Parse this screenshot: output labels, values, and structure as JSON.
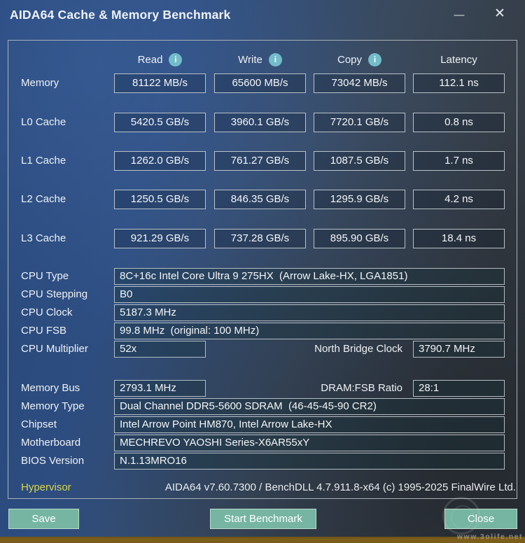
{
  "window": {
    "title": "AIDA64 Cache & Memory Benchmark",
    "minimize_glyph": "—",
    "close_glyph": "✕"
  },
  "icons": {
    "info_glyph": "i"
  },
  "columns": {
    "read": "Read",
    "write": "Write",
    "copy": "Copy",
    "latency": "Latency"
  },
  "benchmark_rows": [
    {
      "label": "Memory",
      "read": "81122 MB/s",
      "write": "65600 MB/s",
      "copy": "73042 MB/s",
      "latency": "112.1 ns"
    },
    {
      "label": "L0 Cache",
      "read": "5420.5 GB/s",
      "write": "3960.1 GB/s",
      "copy": "7720.1 GB/s",
      "latency": "0.8 ns"
    },
    {
      "label": "L1 Cache",
      "read": "1262.0 GB/s",
      "write": "761.27 GB/s",
      "copy": "1087.5 GB/s",
      "latency": "1.7 ns"
    },
    {
      "label": "L2 Cache",
      "read": "1250.5 GB/s",
      "write": "846.35 GB/s",
      "copy": "1295.9 GB/s",
      "latency": "4.2 ns"
    },
    {
      "label": "L3 Cache",
      "read": "921.29 GB/s",
      "write": "737.28 GB/s",
      "copy": "895.90 GB/s",
      "latency": "18.4 ns"
    }
  ],
  "cpu": {
    "type_label": "CPU Type",
    "type": "8C+16c Intel Core Ultra 9 275HX  (Arrow Lake-HX, LGA1851)",
    "stepping_label": "CPU Stepping",
    "stepping": "B0",
    "clock_label": "CPU Clock",
    "clock": "5187.3 MHz",
    "fsb_label": "CPU FSB",
    "fsb": "99.8 MHz  (original: 100 MHz)",
    "multiplier_label": "CPU Multiplier",
    "multiplier": "52x",
    "north_bridge_label": "North Bridge Clock",
    "north_bridge": "3790.7 MHz"
  },
  "system": {
    "memory_bus_label": "Memory Bus",
    "memory_bus": "2793.1 MHz",
    "dram_fsb_label": "DRAM:FSB Ratio",
    "dram_fsb": "28:1",
    "memory_type_label": "Memory Type",
    "memory_type": "Dual Channel DDR5-5600 SDRAM  (46-45-45-90 CR2)",
    "chipset_label": "Chipset",
    "chipset": "Intel Arrow Point HM870, Intel Arrow Lake-HX",
    "motherboard_label": "Motherboard",
    "motherboard": "MECHREVO YAOSHI Series-X6AR55xY",
    "bios_label": "BIOS Version",
    "bios": "N.1.13MRO16"
  },
  "footer": {
    "hypervisor_label": "Hypervisor",
    "version_text": "AIDA64 v7.60.7300 / BenchDLL 4.7.911.8-x64  (c) 1995-2025 FinalWire Ltd."
  },
  "buttons": {
    "save": "Save",
    "start": "Start Benchmark",
    "close": "Close"
  },
  "watermark": "www.3olife.net",
  "colors": {
    "button_accent": "#75b5a2",
    "info_icon": "#73bcca",
    "hypervisor_text": "#d6d74b",
    "bottom_bar": "#7a5c1a",
    "panel_border": "#a7b1b8",
    "background_left": "#2d4d80",
    "background_right": "#31373e"
  }
}
